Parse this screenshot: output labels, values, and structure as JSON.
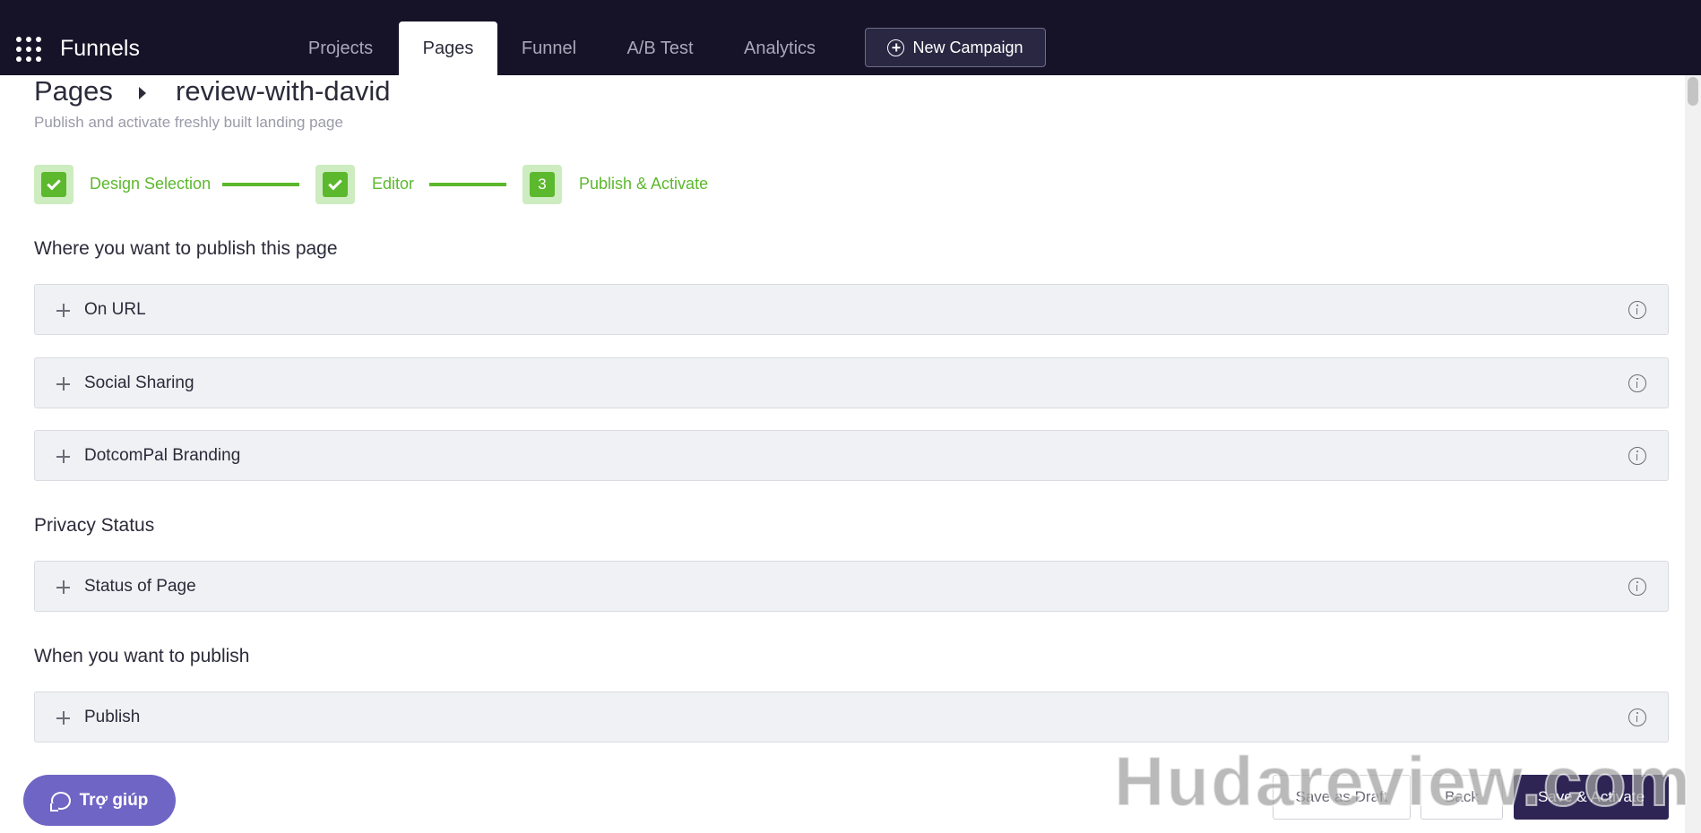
{
  "app": {
    "title": "Funnels"
  },
  "nav": {
    "tabs": [
      {
        "label": "Projects"
      },
      {
        "label": "Pages"
      },
      {
        "label": "Funnel"
      },
      {
        "label": "A/B Test"
      },
      {
        "label": "Analytics"
      }
    ],
    "new_campaign_label": "New Campaign"
  },
  "breadcrumb": {
    "root": "Pages",
    "current": "review-with-david"
  },
  "subtitle": "Publish and activate freshly built landing page",
  "steps": [
    {
      "label": "Design Selection",
      "status": "completed"
    },
    {
      "label": "Editor",
      "status": "completed"
    },
    {
      "number": "3",
      "label": "Publish & Activate",
      "status": "current"
    }
  ],
  "sections": [
    {
      "title": "Where you want to publish this page",
      "panels": [
        "On URL",
        "Social Sharing",
        "DotcomPal Branding"
      ]
    },
    {
      "title": "Privacy Status",
      "panels": [
        "Status of Page"
      ]
    },
    {
      "title": "When you want to publish",
      "panels": [
        "Publish"
      ]
    }
  ],
  "help_button": "Trợ giúp",
  "footer": {
    "save_draft": "Save as Draft",
    "back": "Back",
    "save_activate": "Save & Activate"
  },
  "watermark": "Hudareview.com",
  "colors": {
    "topbar": "#161328",
    "accent_green": "#5cb82d",
    "primary_button": "#2e2555",
    "help_button": "#6f65c4",
    "panel_bg": "#f0f1f4"
  }
}
